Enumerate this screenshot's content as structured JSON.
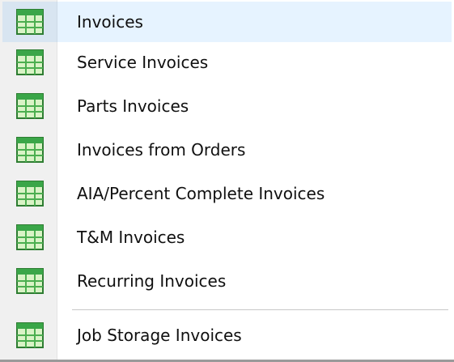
{
  "menu": {
    "items": [
      {
        "label": "Invoices",
        "icon": "table-icon"
      },
      {
        "label": "Service Invoices",
        "icon": "table-icon"
      },
      {
        "label": "Parts Invoices",
        "icon": "table-icon"
      },
      {
        "label": "Invoices from Orders",
        "icon": "table-icon"
      },
      {
        "label": "AIA/Percent Complete Invoices",
        "icon": "table-icon"
      },
      {
        "label": "T&M Invoices",
        "icon": "table-icon"
      },
      {
        "label": "Recurring Invoices",
        "icon": "table-icon"
      },
      {
        "label": "Job Storage Invoices",
        "icon": "table-icon"
      }
    ]
  },
  "colors": {
    "icon_fill": "#2e9b3a",
    "icon_light": "#d9f3c6",
    "gutter": "#f0f0f0"
  }
}
